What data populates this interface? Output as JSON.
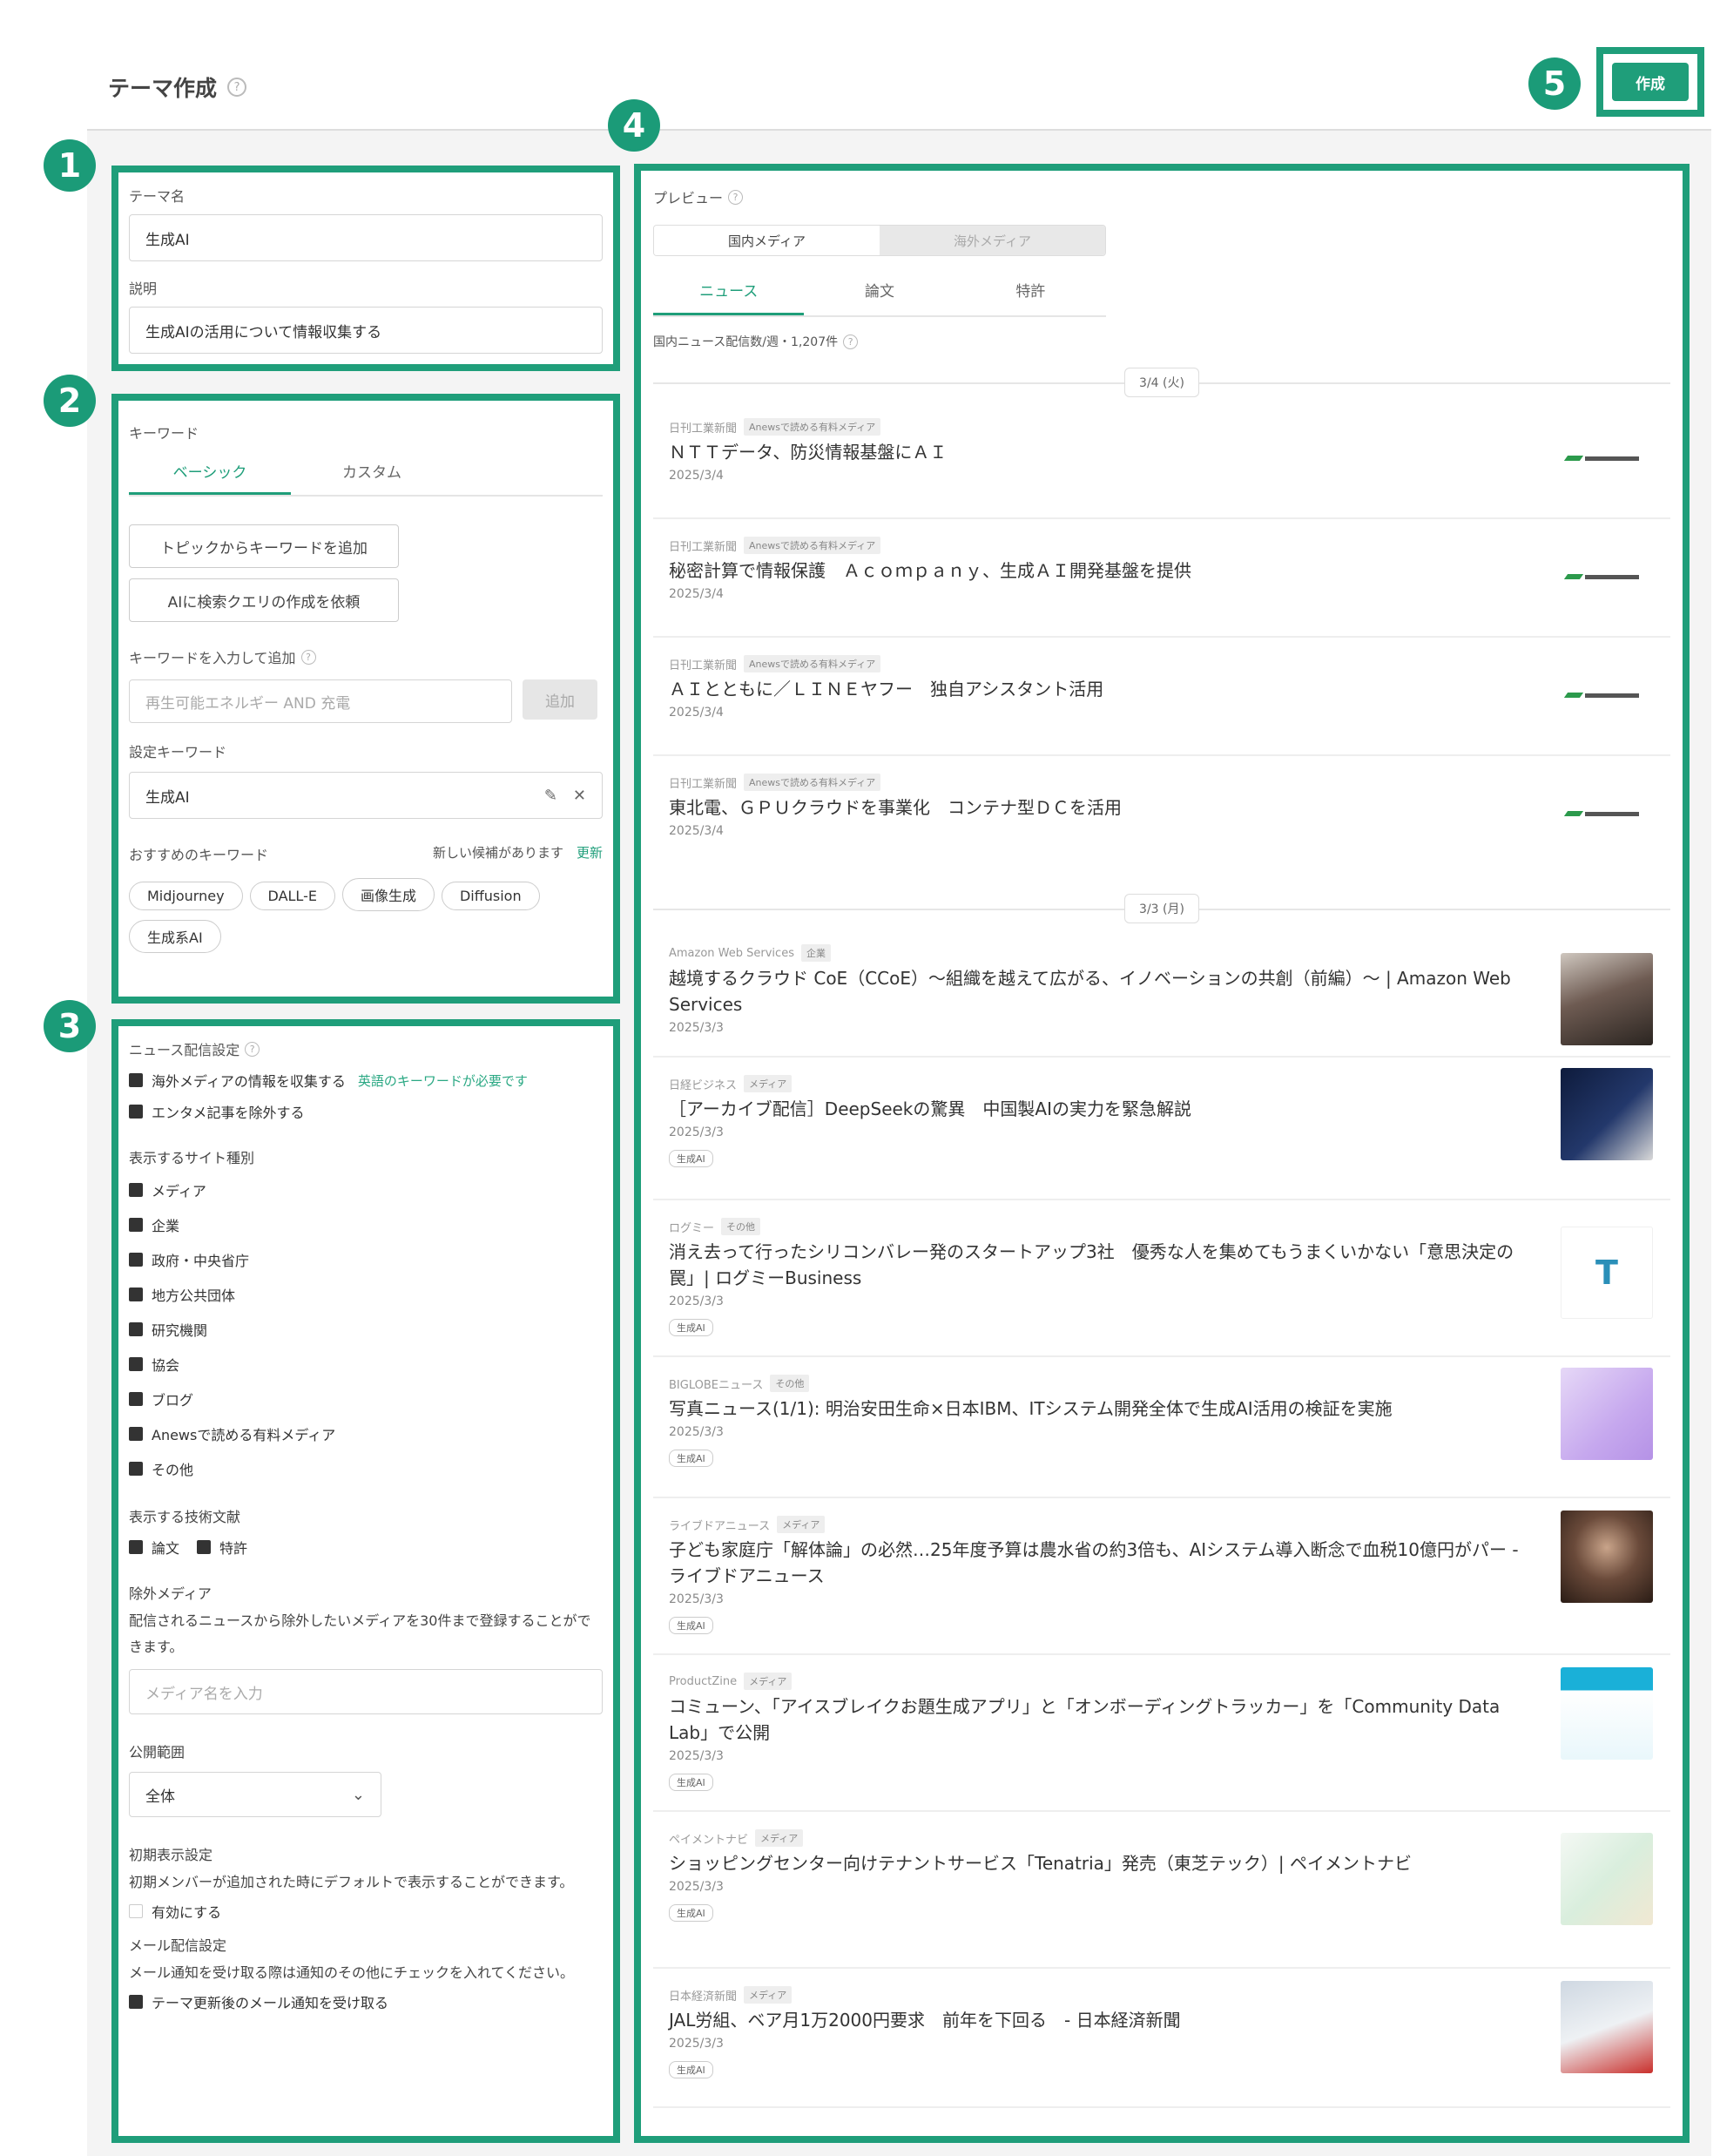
{
  "page": {
    "title": "テーマ作成",
    "create_label": "作成"
  },
  "markers": {
    "m1": "1",
    "m2": "2",
    "m3": "3",
    "m4": "4",
    "m5": "5"
  },
  "theme": {
    "name_label": "テーマ名",
    "name_value": "生成AI",
    "desc_label": "説明",
    "desc_value": "生成AIの活用について情報収集する"
  },
  "keywords": {
    "section_label": "キーワード",
    "tabs": [
      "ベーシック",
      "カスタム"
    ],
    "add_from_topic": "トピックからキーワードを追加",
    "ask_ai": "AIに検索クエリの作成を依頼",
    "input_label": "キーワードを入力して追加",
    "input_placeholder": "再生可能エネルギー AND 充電",
    "add_button": "追加",
    "set_label": "設定キーワード",
    "set_value": "生成AI",
    "suggest_label": "おすすめのキーワード",
    "new_candidates": "新しい候補があります",
    "refresh": "更新",
    "chips": [
      "Midjourney",
      "DALL-E",
      "画像生成",
      "Diffusion",
      "生成系AI"
    ]
  },
  "news": {
    "section_label": "ニュース配信設定",
    "overseas": "海外メディアの情報を収集する",
    "overseas_note": "英語のキーワードが必要です",
    "exclude_ent": "エンタメ記事を除外する",
    "site_types_label": "表示するサイト種別",
    "site_types": [
      "メディア",
      "企業",
      "政府・中央省庁",
      "地方公共団体",
      "研究機関",
      "協会",
      "ブログ",
      "Anewsで読める有料メディア",
      "その他"
    ],
    "tech_label": "表示する技術文献",
    "tech": [
      "論文",
      "特許"
    ],
    "exclude_media_label": "除外メディア",
    "exclude_media_desc": "配信されるニュースから除外したいメディアを30件まで登録することができます。",
    "exclude_media_placeholder": "メディア名を入力",
    "scope_label": "公開範囲",
    "scope_value": "全体",
    "initial_label": "初期表示設定",
    "initial_desc": "初期メンバーが追加された時にデフォルトで表示することができます。",
    "initial_enable": "有効にする",
    "mail_label": "メール配信設定",
    "mail_desc": "メール通知を受け取る際は通知のその他にチェックを入れてください。",
    "mail_check": "テーマ更新後のメール通知を受け取る"
  },
  "preview": {
    "label": "プレビュー",
    "media_tabs": [
      "国内メディア",
      "海外メディア"
    ],
    "content_tabs": [
      "ニュース",
      "論文",
      "特許"
    ],
    "count_text": "国内ニュース配信数/週・1,207件",
    "date1": "3/4 (火)",
    "date2": "3/3 (月)",
    "articles_a": [
      {
        "src": "日刊工業新聞",
        "tag": "Anewsで読める有料メディア",
        "title": "ＮＴＴデータ、防災情報基盤にＡＩ",
        "date": "2025/3/4"
      },
      {
        "src": "日刊工業新聞",
        "tag": "Anewsで読める有料メディア",
        "title": "秘密計算で情報保護　Ａｃｏｍｐａｎｙ、生成ＡＩ開発基盤を提供",
        "date": "2025/3/4"
      },
      {
        "src": "日刊工業新聞",
        "tag": "Anewsで読める有料メディア",
        "title": "ＡＩとともに／ＬＩＮＥヤフー　独自アシスタント活用",
        "date": "2025/3/4"
      },
      {
        "src": "日刊工業新聞",
        "tag": "Anewsで読める有料メディア",
        "title": "東北電、ＧＰＵクラウドを事業化　コンテナ型ＤＣを活用",
        "date": "2025/3/4"
      }
    ],
    "articles_b": [
      {
        "src": "Amazon Web Services",
        "tag": "企業",
        "title": "越境するクラウド CoE（CCoE）〜組織を越えて広がる、イノベーションの共創（前編）〜 | Amazon Web Services",
        "date": "2025/3/3",
        "label": ""
      },
      {
        "src": "日経ビジネス",
        "tag": "メディア",
        "title": "［アーカイブ配信］DeepSeekの驚異　中国製AIの実力を緊急解説",
        "date": "2025/3/3",
        "label": "生成AI"
      },
      {
        "src": "ログミー",
        "tag": "その他",
        "title": "消え去って行ったシリコンバレー発のスタートアップ3社　優秀な人を集めてもうまくいかない「意思決定の罠」| ログミーBusiness",
        "date": "2025/3/3",
        "label": "生成AI"
      },
      {
        "src": "BIGLOBEニュース",
        "tag": "その他",
        "title": "写真ニュース(1/1): 明治安田生命×日本IBM、ITシステム開発全体で生成AI活用の検証を実施",
        "date": "2025/3/3",
        "label": "生成AI"
      },
      {
        "src": "ライブドアニュース",
        "tag": "メディア",
        "title": "子ども家庭庁「解体論」の必然…25年度予算は農水省の約3倍も、AIシステム導入断念で血税10億円がパー - ライブドアニュース",
        "date": "2025/3/3",
        "label": "生成AI"
      },
      {
        "src": "ProductZine",
        "tag": "メディア",
        "title": "コミューン、「アイスブレイクお題生成アプリ」と「オンボーディングトラッカー」を「Community Data Lab」で公開",
        "date": "2025/3/3",
        "label": "生成AI"
      },
      {
        "src": "ペイメントナビ",
        "tag": "メディア",
        "title": "ショッピングセンター向けテナントサービス「Tenatria」発売（東芝テック）| ペイメントナビ",
        "date": "2025/3/3",
        "label": "生成AI"
      },
      {
        "src": "日本経済新聞",
        "tag": "メディア",
        "title": "JAL労組、ベア月1万2000円要求　前年を下回る　- 日本経済新聞",
        "date": "2025/3/3",
        "label": "生成AI"
      }
    ]
  }
}
